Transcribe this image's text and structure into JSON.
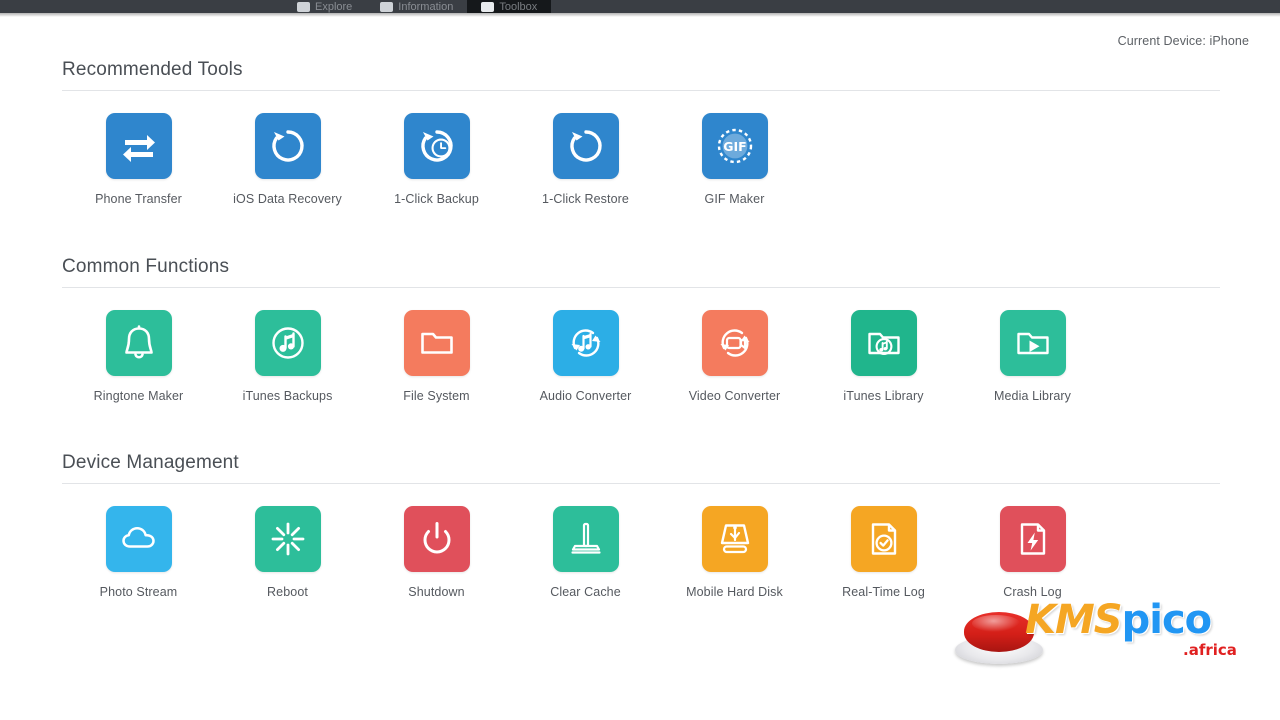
{
  "window": {
    "nav_tabs": [
      {
        "label": "Explore",
        "icon": "device-icon",
        "active": false
      },
      {
        "label": "Information",
        "icon": "info-icon",
        "active": false
      },
      {
        "label": "Toolbox",
        "icon": "grid-icon",
        "active": true
      }
    ]
  },
  "status": {
    "device_text": "Current Device: iPhone"
  },
  "sections": [
    {
      "title": "Recommended Tools",
      "tiles": [
        {
          "label": "Phone Transfer",
          "icon": "transfer-arrows-icon",
          "color": "#2f86cd"
        },
        {
          "label": "iOS Data Recovery",
          "icon": "restore-circle-icon",
          "color": "#2f86cd"
        },
        {
          "label": "1-Click Backup",
          "icon": "backup-clock-icon",
          "color": "#2f86cd"
        },
        {
          "label": "1-Click Restore",
          "icon": "restore-arrow-icon",
          "color": "#2f86cd"
        },
        {
          "label": "GIF Maker",
          "icon": "gif-icon",
          "color": "#2f86cd"
        }
      ]
    },
    {
      "title": "Common Functions",
      "tiles": [
        {
          "label": "Ringtone Maker",
          "icon": "bell-icon",
          "color": "#2dbe9a"
        },
        {
          "label": "iTunes Backups",
          "icon": "itunes-note-icon",
          "color": "#2dbe9a"
        },
        {
          "label": "File System",
          "icon": "folder-icon",
          "color": "#f47b5e"
        },
        {
          "label": "Audio Converter",
          "icon": "audio-convert-icon",
          "color": "#2caee6"
        },
        {
          "label": "Video Converter",
          "icon": "video-convert-icon",
          "color": "#f47b5e"
        },
        {
          "label": "iTunes Library",
          "icon": "folder-music-icon",
          "color": "#20b58c"
        },
        {
          "label": "Media Library",
          "icon": "folder-play-icon",
          "color": "#2dbe9a"
        }
      ]
    },
    {
      "title": "Device Management",
      "tiles": [
        {
          "label": "Photo Stream",
          "icon": "cloud-icon",
          "color": "#34b5ec"
        },
        {
          "label": "Reboot",
          "icon": "reboot-burst-icon",
          "color": "#2dbe9a"
        },
        {
          "label": "Shutdown",
          "icon": "power-icon",
          "color": "#e0505b"
        },
        {
          "label": "Clear Cache",
          "icon": "broom-icon",
          "color": "#2dbe9a"
        },
        {
          "label": "Mobile Hard Disk",
          "icon": "usb-disk-icon",
          "color": "#f5a623"
        },
        {
          "label": "Real-Time Log",
          "icon": "log-check-icon",
          "color": "#f5a623"
        },
        {
          "label": "Crash Log",
          "icon": "crash-bolt-icon",
          "color": "#e0505b"
        }
      ]
    }
  ],
  "watermark": {
    "text_primary": "KMS",
    "text_secondary": "pico",
    "text_tld": ".africa"
  }
}
